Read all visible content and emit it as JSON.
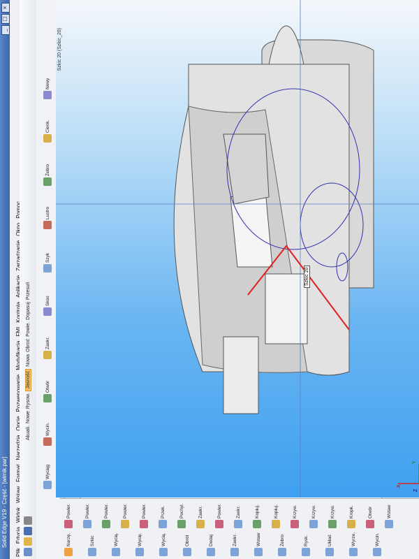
{
  "window": {
    "title": "Solid Edge V19 - Część - [wirnik.par]"
  },
  "menu": [
    "Plik",
    "Edycja",
    "Widok",
    "Wstaw",
    "Format",
    "Narzędzia",
    "Opcje",
    "Pozwenowanie",
    "Modyfikacja",
    "FMI",
    "Kontrola",
    "Aplikacje",
    "Zarządzanie",
    "Okno",
    "Pomoc"
  ],
  "toolbar": {
    "items": [
      "Akuali.",
      "Nowe",
      "Rysow.",
      "Jasność",
      "Nowa",
      "Obroć",
      "Powie.",
      "Dopasuj",
      "Przesuń"
    ]
  },
  "ribbon": {
    "items": [
      "Wyciąg",
      "Wycin.",
      "Otwór",
      "Zaokr.",
      "Skos",
      "Szyk",
      "Lustro",
      "Żebro",
      "Cienk.",
      "Nowy"
    ]
  },
  "commands": {
    "col1": [
      "Narzę.",
      "Szkic",
      "Wycią.",
      "Wycię.",
      "Wycią.",
      "Obrót",
      "Dodaj",
      "Zaokr.",
      "Wstaw",
      "Żebro",
      "Rysk.",
      "Układ",
      "Wyrze.",
      "Wycin."
    ],
    "col2": [
      "Powier.",
      "Powier.",
      "Powier.",
      "Powier.",
      "Powier.",
      "Przek.",
      "Pochyl.",
      "Zaokr.",
      "Powier.",
      "Zaokr.",
      "Kopiuj.",
      "Kopiuj.",
      "Krzyw.",
      "Krzyw.",
      "Krzyw.",
      "Kropk.",
      "Otwór",
      "Wstaw"
    ]
  },
  "pathfinder": {
    "nodes": [
      "wirnik.par",
      "Z góry (xy)",
      "Z prawej (yz)",
      "Z przodu (xz)",
      "Szkic 1",
      "Wyciągnięcie 1",
      "Szkic 7",
      "Wyciągnięcie 2",
      "Szkic 8",
      "Szkic 9",
      "Szkic 17",
      "Wyciągnięcie 3",
      "Szkic 19",
      "Szkic 20"
    ]
  },
  "viewport": {
    "title": "Szkic 20 (Szkic_20)",
    "tag": "Szkic 20",
    "axes": {
      "x": "X",
      "y": "Y",
      "z": "Z"
    }
  }
}
